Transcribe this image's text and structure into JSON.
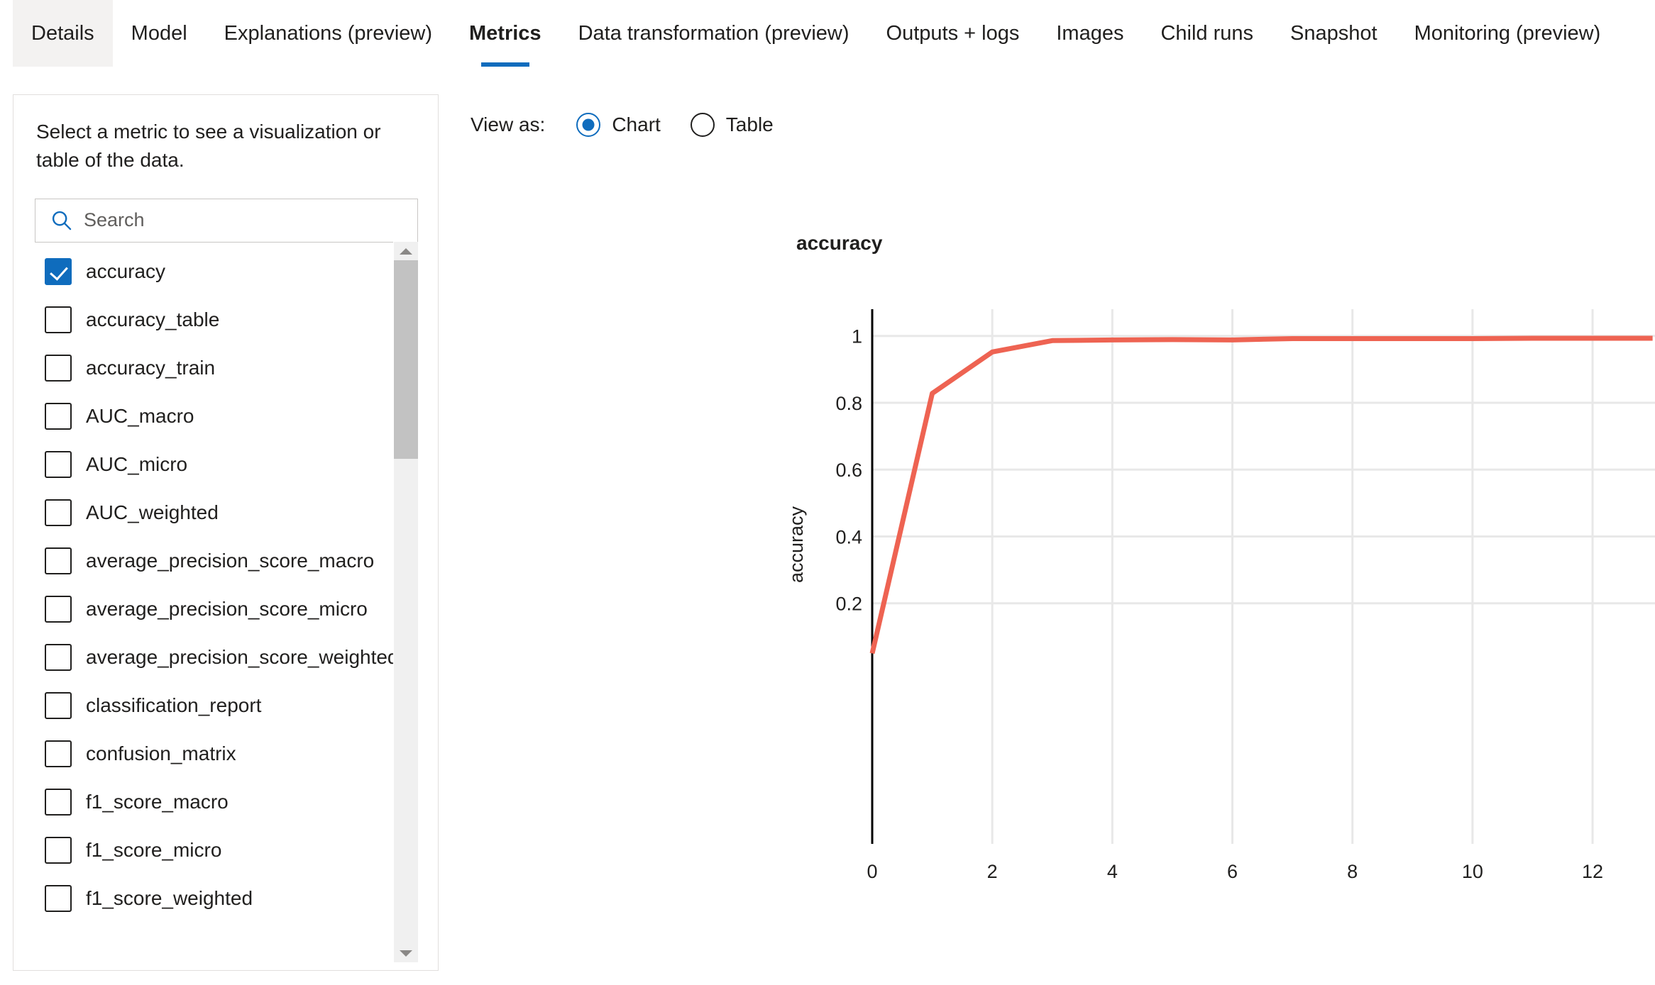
{
  "tabs": [
    {
      "label": "Details",
      "state": "hovered"
    },
    {
      "label": "Model",
      "state": "normal"
    },
    {
      "label": "Explanations (preview)",
      "state": "normal"
    },
    {
      "label": "Metrics",
      "state": "active"
    },
    {
      "label": "Data transformation (preview)",
      "state": "normal"
    },
    {
      "label": "Outputs + logs",
      "state": "normal"
    },
    {
      "label": "Images",
      "state": "normal"
    },
    {
      "label": "Child runs",
      "state": "normal"
    },
    {
      "label": "Snapshot",
      "state": "normal"
    },
    {
      "label": "Monitoring (preview)",
      "state": "normal"
    }
  ],
  "left_panel": {
    "description": "Select a metric to see a visualization or table of the data.",
    "search": {
      "placeholder": "Search",
      "value": "",
      "icon": "search-icon"
    },
    "metrics": [
      {
        "label": "accuracy",
        "checked": true
      },
      {
        "label": "accuracy_table",
        "checked": false
      },
      {
        "label": "accuracy_train",
        "checked": false
      },
      {
        "label": "AUC_macro",
        "checked": false
      },
      {
        "label": "AUC_micro",
        "checked": false
      },
      {
        "label": "AUC_weighted",
        "checked": false
      },
      {
        "label": "average_precision_score_macro",
        "checked": false
      },
      {
        "label": "average_precision_score_micro",
        "checked": false
      },
      {
        "label": "average_precision_score_weighted",
        "checked": false
      },
      {
        "label": "classification_report",
        "checked": false
      },
      {
        "label": "confusion_matrix",
        "checked": false
      },
      {
        "label": "f1_score_macro",
        "checked": false
      },
      {
        "label": "f1_score_micro",
        "checked": false
      },
      {
        "label": "f1_score_weighted",
        "checked": false
      }
    ],
    "scrollbar": {
      "up_arrow_icon": "chevron-up-icon",
      "down_arrow_icon": "chevron-down-icon"
    }
  },
  "view_as": {
    "label": "View as:",
    "options": [
      {
        "label": "Chart",
        "selected": true
      },
      {
        "label": "Table",
        "selected": false
      }
    ]
  },
  "colors": {
    "accent": "#0f6cbd",
    "line": "#ee6352",
    "grid": "#e8e8e8",
    "axis": "#000000"
  },
  "chart_data": {
    "type": "line",
    "title": "accuracy",
    "xlabel": "",
    "ylabel": "accuracy",
    "x": [
      0,
      1,
      2,
      3,
      4,
      5,
      6,
      7,
      8,
      9,
      10,
      11,
      12,
      13
    ],
    "series": [
      {
        "name": "accuracy",
        "values": [
          0.05,
          0.828,
          0.952,
          0.986,
          0.988,
          0.989,
          0.988,
          0.992,
          0.992,
          0.992,
          0.992,
          0.993,
          0.993,
          0.993
        ]
      }
    ],
    "xticks": [
      0,
      2,
      4,
      6,
      8,
      10,
      12
    ],
    "yticks": [
      0.2,
      0.4,
      0.6,
      0.8,
      1
    ],
    "xlim": [
      0,
      13.04
    ],
    "ylim": [
      -0.52,
      1.08
    ],
    "grid": true,
    "legend": false
  }
}
